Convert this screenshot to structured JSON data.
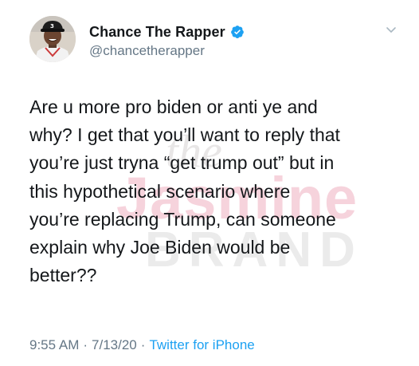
{
  "user": {
    "display_name": "Chance The Rapper",
    "handle": "@chancetherapper",
    "verified": true
  },
  "tweet": {
    "text": "Are u more pro biden or anti ye and\nwhy? I get that you’ll want to reply that\nyou’re just tryna “get trump out” but in\nthis hypothetical scenario where\nyou’re replacing Trump, can someone\nexplain why Joe Biden would be\nbetter??"
  },
  "meta": {
    "time": "9:55 AM",
    "separator": "·",
    "date": "7/13/20",
    "source": "Twitter for iPhone"
  },
  "watermark": {
    "line1": "the",
    "line2": "Jasmine",
    "line3": "BRAND"
  },
  "colors": {
    "text": "#14171a",
    "secondary": "#657786",
    "link": "#1da1f2",
    "verified": "#1da1f2",
    "watermark_pink": "#f6d3dc"
  },
  "icons": {
    "verified": "verified-badge-icon",
    "menu": "chevron-down-icon"
  }
}
